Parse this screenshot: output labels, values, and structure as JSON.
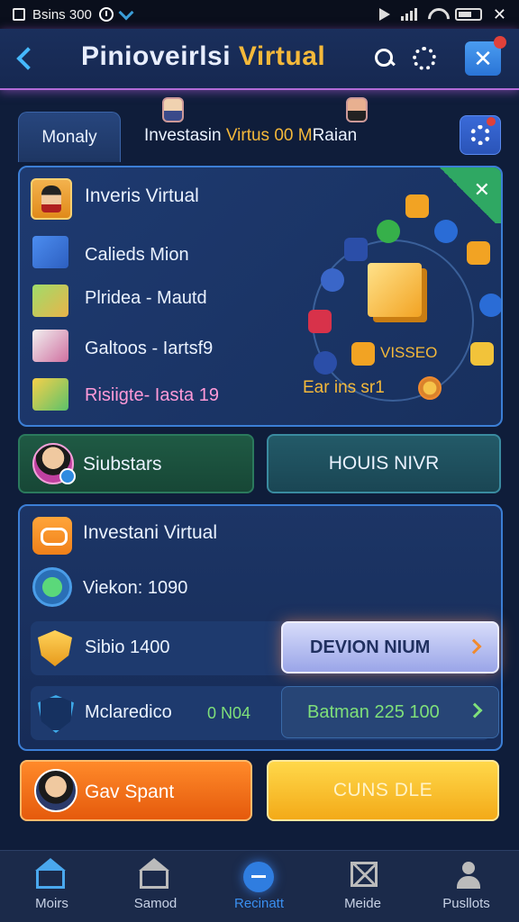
{
  "status_bar": {
    "app_label": "Bsins 300"
  },
  "header": {
    "title_part1": "Pinioveirlsi",
    "title_part2": "Virtual"
  },
  "tabs": {
    "active_label": "Monaly",
    "secondary_label_a": "Investasin ",
    "secondary_label_b": "Virtus 00 M",
    "secondary_label_c": "Raian"
  },
  "card_overview": {
    "title": "Inveris Virtual",
    "rows": [
      {
        "label": "Calieds Mion",
        "icon": "blocks-icon"
      },
      {
        "label": "Plridea - Mautd",
        "icon": "cash-stack-icon"
      },
      {
        "label": "Galtoos - Iartsf9",
        "icon": "gift-box-icon"
      },
      {
        "label": "Risiigte- Iasta 19",
        "icon": "money-icon"
      }
    ],
    "illustration_label": "VISSEO",
    "earn_label": "Ear ins sr1"
  },
  "action_row": {
    "subscribe_label": "Siubstars",
    "hours_label": "HOUIS NIVR"
  },
  "card_invest": {
    "title": "Investani Virtual",
    "value_label": "Viekon: 1090",
    "row1": {
      "label": "Sibio 1400",
      "button": "DEVION NIUM"
    },
    "row2": {
      "label": "Mclaredico",
      "badge": "0 N04",
      "button": "Batman 225 100"
    }
  },
  "bottom_buttons": {
    "left_label": "Gav Spant",
    "right_label": "CUNS DLE"
  },
  "nav": [
    {
      "label": "Moirs",
      "icon": "home-icon",
      "active": false
    },
    {
      "label": "Samod",
      "icon": "house-icon",
      "active": false
    },
    {
      "label": "Recinatt",
      "icon": "plus-icon",
      "active": true
    },
    {
      "label": "Meide",
      "icon": "envelope-icon",
      "active": false
    },
    {
      "label": "Pusllots",
      "icon": "person-icon",
      "active": false
    }
  ],
  "colors": {
    "accent": "#f5b93a",
    "primary": "#3c7fd6",
    "background": "#0f1d3a",
    "active_nav": "#3a8ff0"
  }
}
